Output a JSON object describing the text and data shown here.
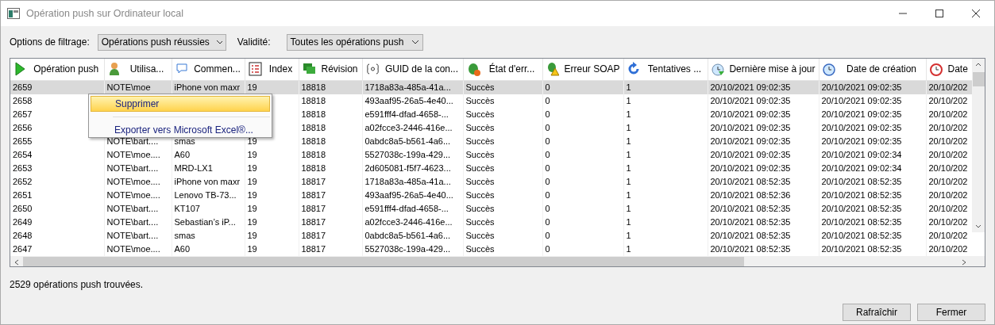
{
  "window": {
    "title": "Opération push sur Ordinateur local"
  },
  "filters": [
    {
      "label": "Options de filtrage:",
      "value": "Opérations push réussies"
    },
    {
      "label": "Validité:",
      "value": "Toutes les opérations push"
    }
  ],
  "table": {
    "columns": [
      "Opération push",
      "Utilisa...",
      "Commen...",
      "Index",
      "Révision",
      "GUID de la con...",
      "État d'err...",
      "Erreur SOAP",
      "Tentatives ...",
      "Dernière mise à jour",
      "Date de création",
      "Date"
    ],
    "rows": [
      {
        "selected": true,
        "cells": [
          "2659",
          "NOTE\\moe",
          "iPhone von maxr",
          "19",
          "18818",
          "1718a83a-485a-41a...",
          "Succès",
          "0",
          "1",
          "20/10/2021 09:02:35",
          "20/10/2021 09:02:35",
          "20/10/202"
        ]
      },
      {
        "selected": false,
        "cells": [
          "2658",
          null,
          null,
          null,
          "18818",
          "493aaf95-26a5-4e40...",
          "Succès",
          "0",
          "1",
          "20/10/2021 09:02:35",
          "20/10/2021 09:02:35",
          "20/10/202"
        ]
      },
      {
        "selected": false,
        "cells": [
          "2657",
          null,
          null,
          null,
          "18818",
          "e591fff4-dfad-4658-...",
          "Succès",
          "0",
          "1",
          "20/10/2021 09:02:35",
          "20/10/2021 09:02:35",
          "20/10/202"
        ]
      },
      {
        "selected": false,
        "cells": [
          "2656",
          null,
          null,
          null,
          "18818",
          "a02fcce3-2446-416e...",
          "Succès",
          "0",
          "1",
          "20/10/2021 09:02:35",
          "20/10/2021 09:02:35",
          "20/10/202"
        ]
      },
      {
        "selected": false,
        "cells": [
          "2655",
          "NOTE\\bart....",
          "smas",
          "19",
          "18818",
          "0abdc8a5-b561-4a6...",
          "Succès",
          "0",
          "1",
          "20/10/2021 09:02:35",
          "20/10/2021 09:02:35",
          "20/10/202"
        ]
      },
      {
        "selected": false,
        "cells": [
          "2654",
          "NOTE\\moe....",
          "A60",
          "19",
          "18818",
          "5527038c-199a-429...",
          "Succès",
          "0",
          "1",
          "20/10/2021 09:02:35",
          "20/10/2021 09:02:34",
          "20/10/202"
        ]
      },
      {
        "selected": false,
        "cells": [
          "2653",
          "NOTE\\bart....",
          "MRD-LX1",
          "19",
          "18818",
          "2d605081-f5f7-4623...",
          "Succès",
          "0",
          "1",
          "20/10/2021 09:02:35",
          "20/10/2021 09:02:34",
          "20/10/202"
        ]
      },
      {
        "selected": false,
        "cells": [
          "2652",
          "NOTE\\moe....",
          "iPhone von maxr",
          "19",
          "18817",
          "1718a83a-485a-41a...",
          "Succès",
          "0",
          "1",
          "20/10/2021 08:52:35",
          "20/10/2021 08:52:35",
          "20/10/202"
        ]
      },
      {
        "selected": false,
        "cells": [
          "2651",
          "NOTE\\moe....",
          "Lenovo TB-73...",
          "19",
          "18817",
          "493aaf95-26a5-4e40...",
          "Succès",
          "0",
          "1",
          "20/10/2021 08:52:36",
          "20/10/2021 08:52:35",
          "20/10/202"
        ]
      },
      {
        "selected": false,
        "cells": [
          "2650",
          "NOTE\\bart....",
          "KT107",
          "19",
          "18817",
          "e591fff4-dfad-4658-...",
          "Succès",
          "0",
          "1",
          "20/10/2021 08:52:35",
          "20/10/2021 08:52:35",
          "20/10/202"
        ]
      },
      {
        "selected": false,
        "cells": [
          "2649",
          "NOTE\\bart....",
          "Sebastian’s iP...",
          "19",
          "18817",
          "a02fcce3-2446-416e...",
          "Succès",
          "0",
          "1",
          "20/10/2021 08:52:35",
          "20/10/2021 08:52:35",
          "20/10/202"
        ]
      },
      {
        "selected": false,
        "cells": [
          "2648",
          "NOTE\\bart....",
          "smas",
          "19",
          "18817",
          "0abdc8a5-b561-4a6...",
          "Succès",
          "0",
          "1",
          "20/10/2021 08:52:35",
          "20/10/2021 08:52:35",
          "20/10/202"
        ]
      },
      {
        "selected": false,
        "cells": [
          "2647",
          "NOTE\\moe....",
          "A60",
          "19",
          "18817",
          "5527038c-199a-429...",
          "Succès",
          "0",
          "1",
          "20/10/2021 08:52:35",
          "20/10/2021 08:52:35",
          "20/10/202"
        ]
      }
    ]
  },
  "context_menu": {
    "items": [
      {
        "label": "Supprimer",
        "selected": true
      },
      {
        "label": "Exporter vers Microsoft Excel®...",
        "selected": false
      }
    ]
  },
  "status_bar": "2529 opérations push trouvées.",
  "buttons": [
    "Rafraîchir",
    "Fermer"
  ]
}
